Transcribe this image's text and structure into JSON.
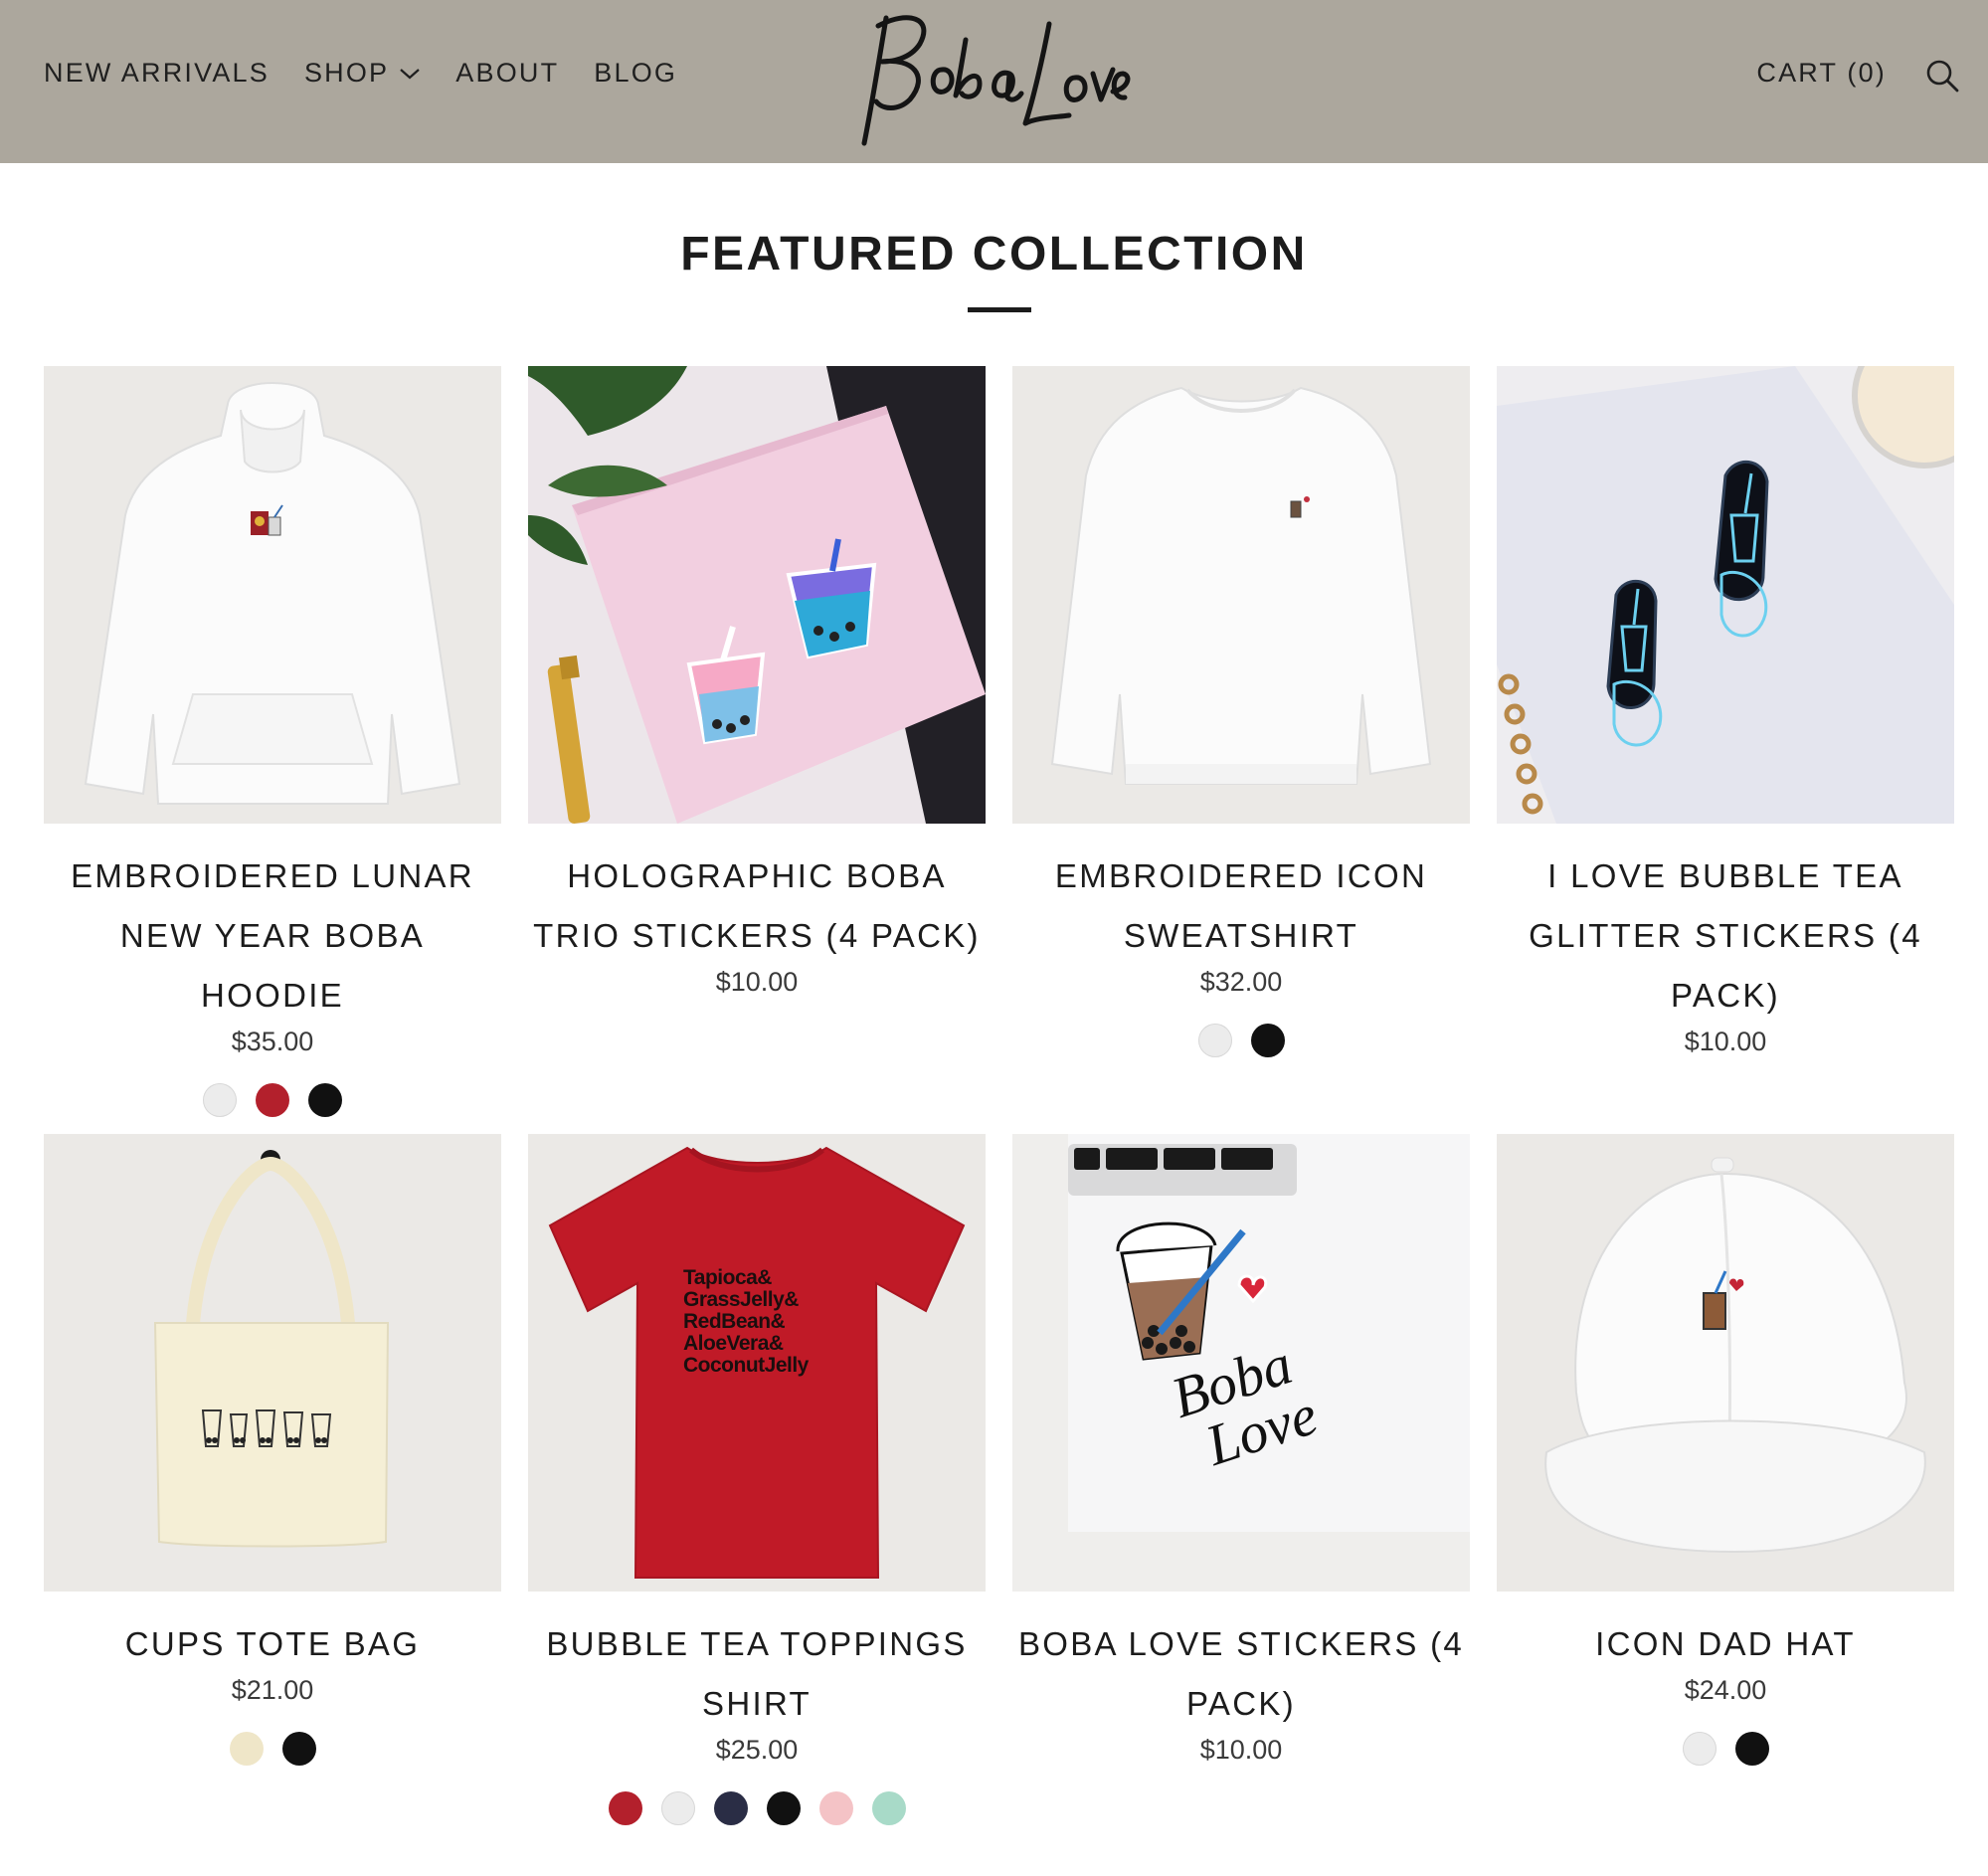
{
  "header": {
    "nav": [
      {
        "label": "NEW ARRIVALS"
      },
      {
        "label": "SHOP"
      },
      {
        "label": "ABOUT"
      },
      {
        "label": "BLOG"
      }
    ],
    "logo_text": "Boba Love",
    "cart_label": "CART (0)"
  },
  "section": {
    "title": "FEATURED COLLECTION"
  },
  "products": [
    {
      "name": "EMBROIDERED LUNAR NEW YEAR BOBA HOODIE",
      "price": "$35.00",
      "swatches": [
        "#ececec",
        "#b3202c",
        "#111111"
      ]
    },
    {
      "name": "HOLOGRAPHIC BOBA TRIO STICKERS (4 PACK)",
      "price": "$10.00",
      "swatches": []
    },
    {
      "name": "EMBROIDERED ICON SWEATSHIRT",
      "price": "$32.00",
      "swatches": [
        "#ececec",
        "#111111"
      ]
    },
    {
      "name": "I LOVE BUBBLE TEA GLITTER STICKERS (4 PACK)",
      "price": "$10.00",
      "swatches": []
    },
    {
      "name": "CUPS TOTE BAG",
      "price": "$21.00",
      "swatches": [
        "#efe6c8",
        "#111111"
      ]
    },
    {
      "name": "BUBBLE TEA TOPPINGS SHIRT",
      "price": "$25.00",
      "swatches": [
        "#b3202c",
        "#ececec",
        "#2a2d45",
        "#111111",
        "#f4c3c6",
        "#a8dac8"
      ]
    },
    {
      "name": "BOBA LOVE STICKERS (4 PACK)",
      "price": "$10.00",
      "swatches": []
    },
    {
      "name": "ICON DAD HAT",
      "price": "$24.00",
      "swatches": [
        "#ececec",
        "#111111"
      ]
    }
  ],
  "shirt_print": [
    "Tapioca&",
    "GrassJelly&",
    "RedBean&",
    "AloeVera&",
    "CoconutJelly"
  ],
  "sticker_logo": [
    "Boba",
    "Love"
  ],
  "colors": {
    "header_bg": "#aca79d",
    "text": "#1c1c1c",
    "image_bg": "#ebe9e6"
  }
}
